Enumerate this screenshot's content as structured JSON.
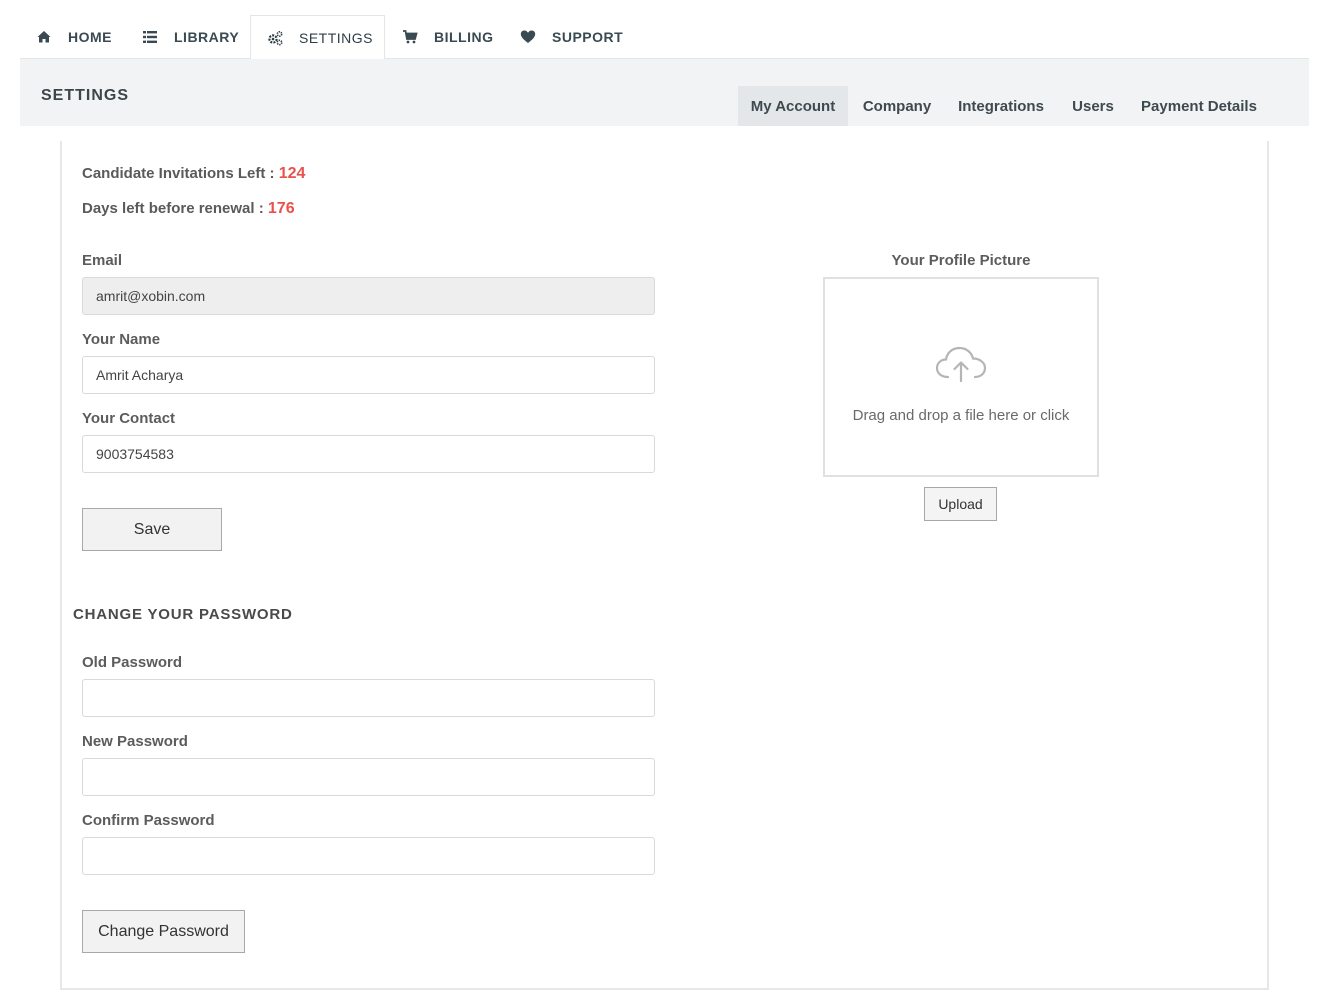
{
  "topnav": {
    "items": [
      {
        "label": "HOME",
        "icon": "home-icon"
      },
      {
        "label": "LIBRARY",
        "icon": "list-icon"
      },
      {
        "label": "SETTINGS",
        "icon": "gears-icon",
        "active": true
      },
      {
        "label": "BILLING",
        "icon": "cart-icon"
      },
      {
        "label": "SUPPORT",
        "icon": "heart-icon"
      }
    ]
  },
  "header": {
    "title": "SETTINGS",
    "tabs": [
      {
        "label": "My Account",
        "active": true
      },
      {
        "label": "Company"
      },
      {
        "label": "Integrations"
      },
      {
        "label": "Users"
      },
      {
        "label": "Payment Details"
      }
    ]
  },
  "stats": {
    "invites_label": "Candidate Invitations Left :",
    "invites_value": "124",
    "days_label": "Days left before renewal :",
    "days_value": "176"
  },
  "account": {
    "email_label": "Email",
    "email_value": "amrit@xobin.com",
    "name_label": "Your Name",
    "name_value": "Amrit Acharya",
    "contact_label": "Your Contact",
    "contact_value": "9003754583",
    "save_label": "Save"
  },
  "password": {
    "heading": "CHANGE YOUR PASSWORD",
    "old_label": "Old Password",
    "new_label": "New Password",
    "confirm_label": "Confirm Password",
    "button_label": "Change Password"
  },
  "profile": {
    "label": "Your Profile Picture",
    "dropzone_text": "Drag and drop a file here or click",
    "upload_label": "Upload"
  },
  "colors": {
    "accent_value": "#e8524a",
    "nav_text": "#3a4a52",
    "header_bg": "#f1f3f4"
  }
}
